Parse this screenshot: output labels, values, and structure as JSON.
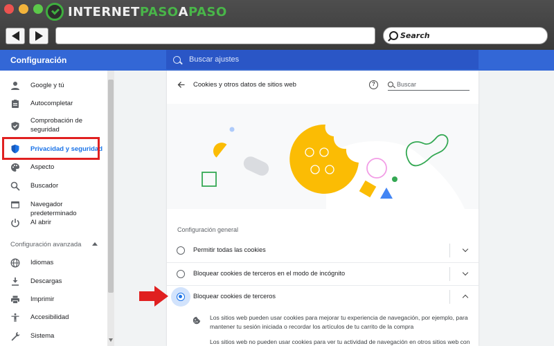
{
  "watermark": {
    "part1": "INTERNET",
    "part2": "PASO",
    "part3": "A",
    "part4": "PASO",
    "color_white": "#f0f0f0",
    "color_green": "#49b649"
  },
  "browser": {
    "search_placeholder": "Search",
    "back_icon": "back-triangle-icon",
    "forward_icon": "forward-triangle-icon"
  },
  "settings": {
    "title": "Configuración",
    "search_placeholder": "Buscar ajustes",
    "header_color": "#3367d6"
  },
  "sidebar": {
    "items": [
      {
        "label": "Google y tú",
        "icon": "person-icon"
      },
      {
        "label": "Autocompletar",
        "icon": "clipboard-icon"
      },
      {
        "label": "Comprobación de seguridad",
        "icon": "shield-check-icon"
      },
      {
        "label": "Privacidad y seguridad",
        "icon": "shield-icon",
        "active": true
      },
      {
        "label": "Aspecto",
        "icon": "palette-icon"
      },
      {
        "label": "Buscador",
        "icon": "search-icon"
      },
      {
        "label": "Navegador predeterminado",
        "icon": "browser-icon"
      },
      {
        "label": "Al abrir",
        "icon": "power-icon"
      }
    ],
    "advanced_header": "Configuración avanzada",
    "advanced_items": [
      {
        "label": "Idiomas",
        "icon": "globe-icon"
      },
      {
        "label": "Descargas",
        "icon": "download-icon"
      },
      {
        "label": "Imprimir",
        "icon": "printer-icon"
      },
      {
        "label": "Accesibilidad",
        "icon": "accessibility-icon"
      },
      {
        "label": "Sistema",
        "icon": "wrench-icon"
      }
    ],
    "active_color": "#1a73e8",
    "highlight_color": "#e02020"
  },
  "page": {
    "title": "Cookies y otros datos de sitios web",
    "search_placeholder": "Buscar",
    "section_label": "Configuración general",
    "options": [
      {
        "label": "Permitir todas las cookies",
        "checked": false,
        "expanded": false
      },
      {
        "label": "Bloquear cookies de terceros en el modo de incógnito",
        "checked": false,
        "expanded": false
      },
      {
        "label": "Bloquear cookies de terceros",
        "checked": true,
        "expanded": true
      }
    ],
    "description_1": "Los sitios web pueden usar cookies para mejorar tu experiencia de navegación, por ejemplo, para mantener tu sesión iniciada o recordar los artículos de tu carrito de la compra",
    "description_2": "Los sitios web no pueden usar cookies para ver tu actividad de navegación en otros sitios web con"
  }
}
